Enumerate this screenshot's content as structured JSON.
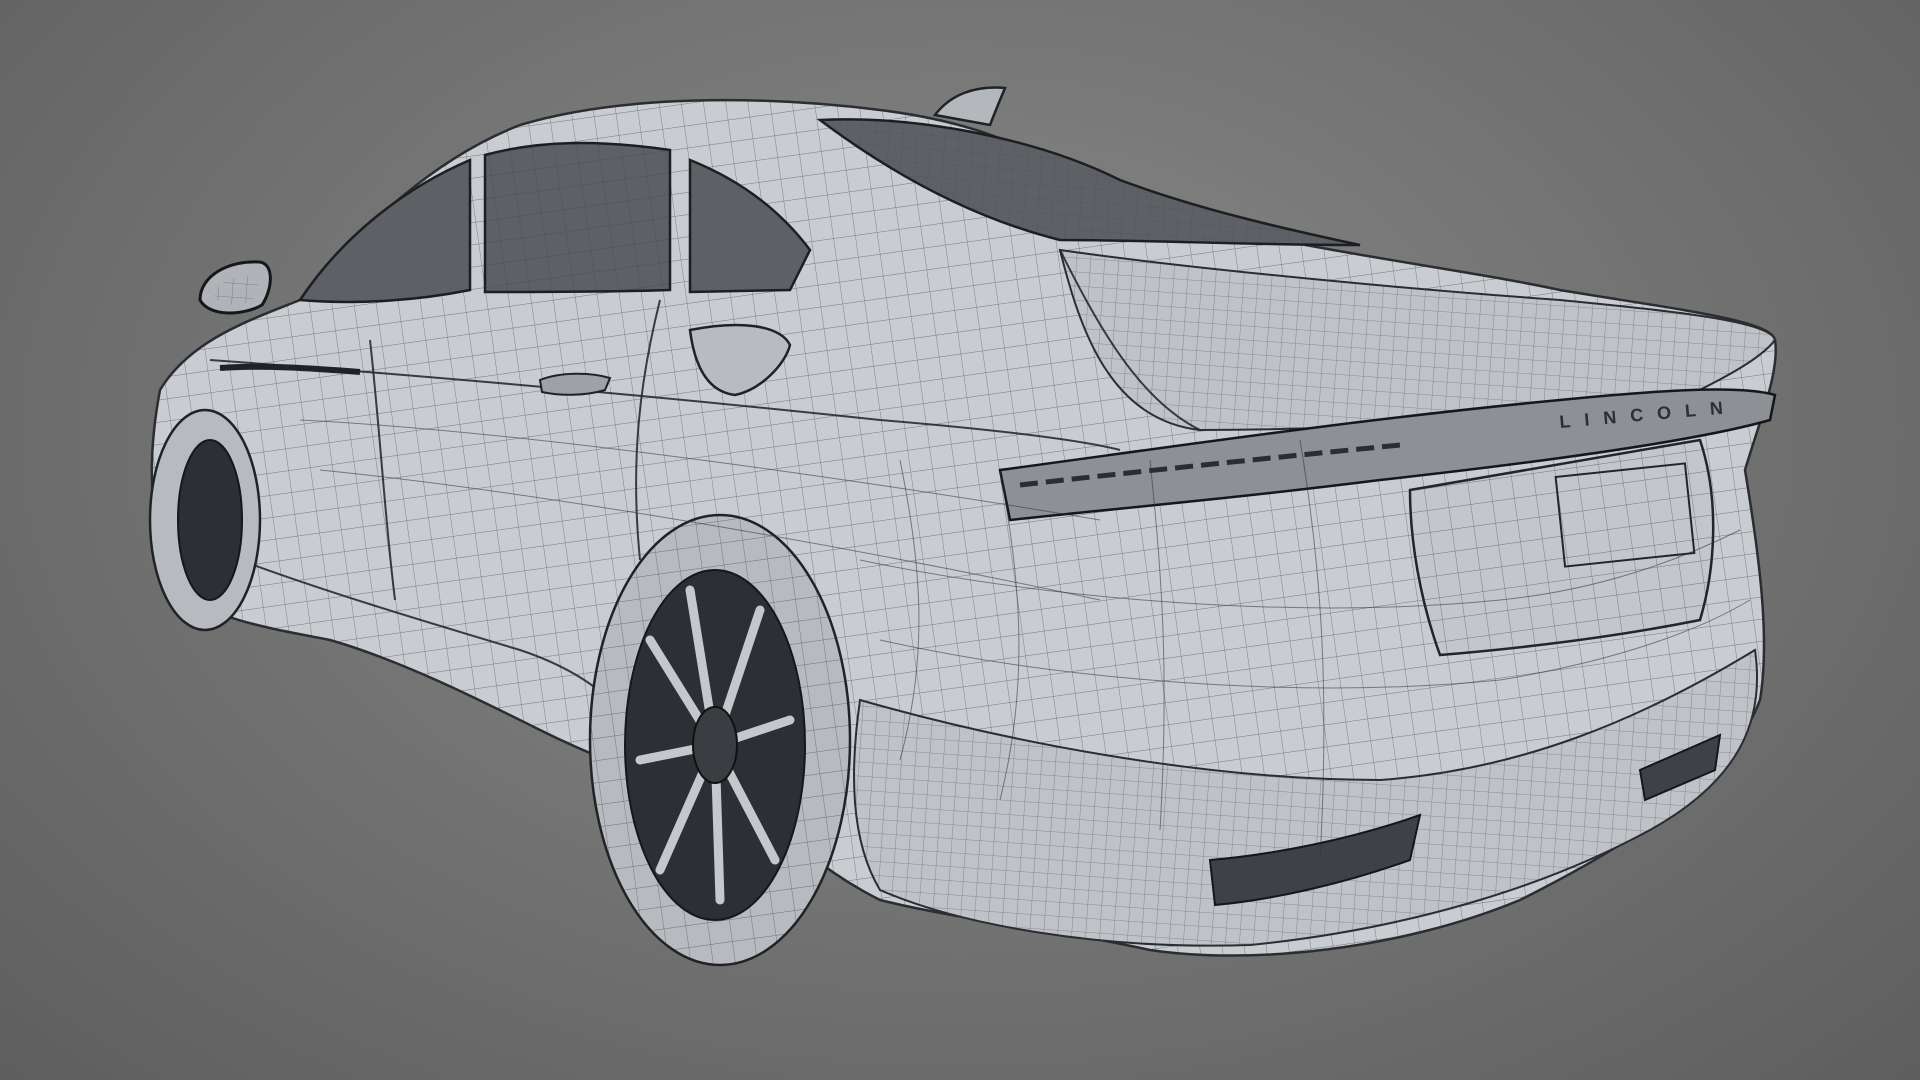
{
  "scene": {
    "background": "#6b6b6b",
    "subject": "car-wireframe",
    "body_color": "#c9ccd0",
    "wire_color": "#2f3236",
    "glass_color": "#5d6064"
  },
  "badges": {
    "rear_badge": "LINCOLN"
  },
  "icons": {
    "side_mirror": "mirror-shape",
    "fuel_door": "fuel-door-shape"
  }
}
